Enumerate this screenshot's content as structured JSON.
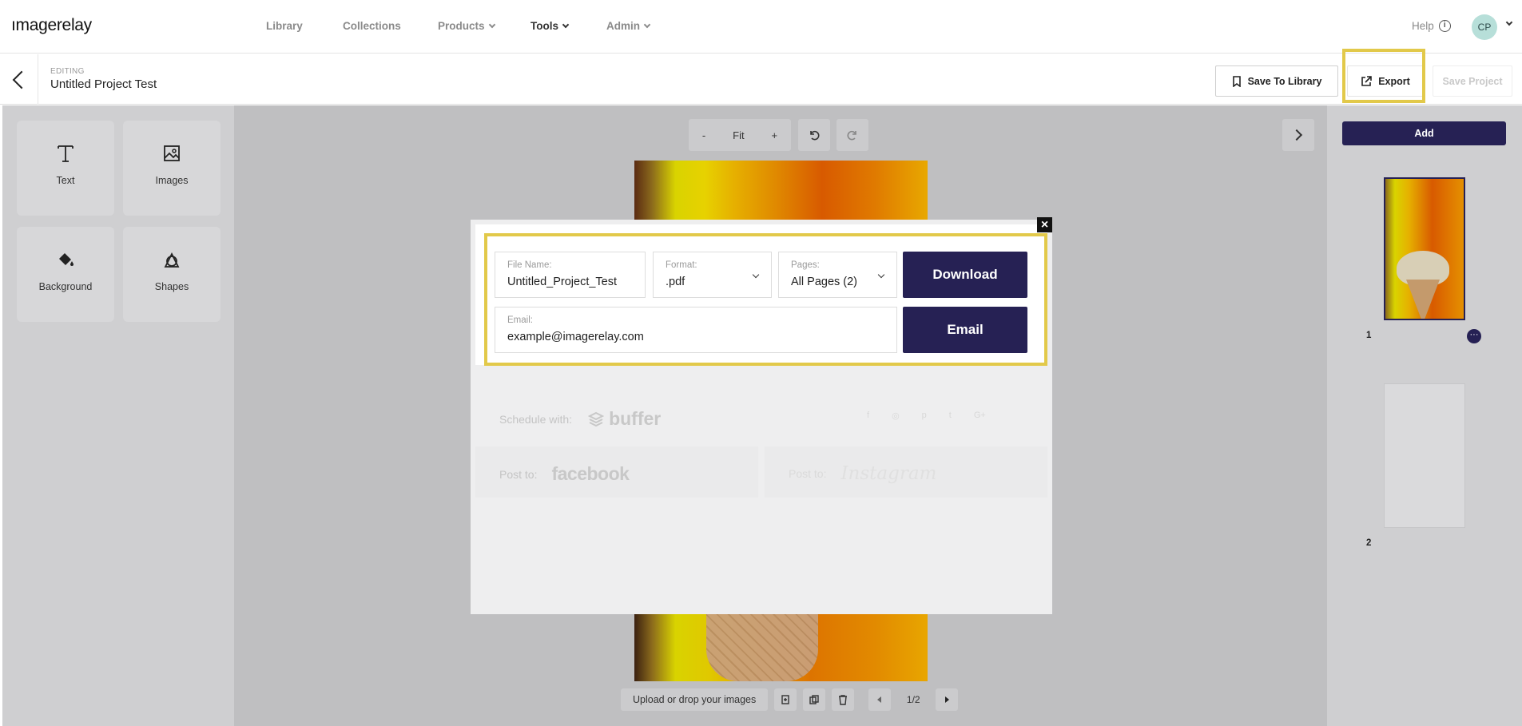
{
  "app": {
    "logo": "ımagerelay",
    "nav": [
      {
        "label": "Library",
        "has_menu": false
      },
      {
        "label": "Collections",
        "has_menu": false
      },
      {
        "label": "Products",
        "has_menu": true
      },
      {
        "label": "Tools",
        "has_menu": true
      },
      {
        "label": "Admin",
        "has_menu": true
      }
    ],
    "help_label": "Help",
    "avatar_initials": "CP"
  },
  "editor": {
    "editing_label": "EDITING",
    "project_title": "Untitled Project Test",
    "save_to_library_label": "Save To Library",
    "export_label": "Export",
    "save_project_label": "Save Project"
  },
  "tools": [
    {
      "label": "Text",
      "icon": "text-icon"
    },
    {
      "label": "Images",
      "icon": "image-icon"
    },
    {
      "label": "Background",
      "icon": "paint-bucket-icon"
    },
    {
      "label": "Shapes",
      "icon": "shapes-icon"
    }
  ],
  "canvas": {
    "zoom_minus": "-",
    "zoom_fit": "Fit",
    "zoom_plus": "+",
    "upload_label": "Upload or drop your images",
    "page_indicator": "1/2"
  },
  "pages_panel": {
    "add_label": "Add",
    "pages": [
      {
        "number": "1"
      },
      {
        "number": "2"
      }
    ],
    "more_icon": "···"
  },
  "export_modal": {
    "file_name_label": "File Name:",
    "file_name_value": "Untitled_Project_Test",
    "format_label": "Format:",
    "format_value": ".pdf",
    "pages_label": "Pages:",
    "pages_value": "All Pages (2)",
    "download_label": "Download",
    "email_label": "Email:",
    "email_value": "example@imagerelay.com",
    "email_button_label": "Email",
    "schedule_label": "Schedule with:",
    "buffer_logo": "buffer",
    "post_to_label": "Post to:",
    "facebook_logo": "facebook",
    "instagram_logo": "Instagram",
    "close_icon": "×"
  },
  "colors": {
    "primary": "#262154",
    "highlight": "#e2c94a",
    "avatar_bg": "#b7dfd9"
  }
}
